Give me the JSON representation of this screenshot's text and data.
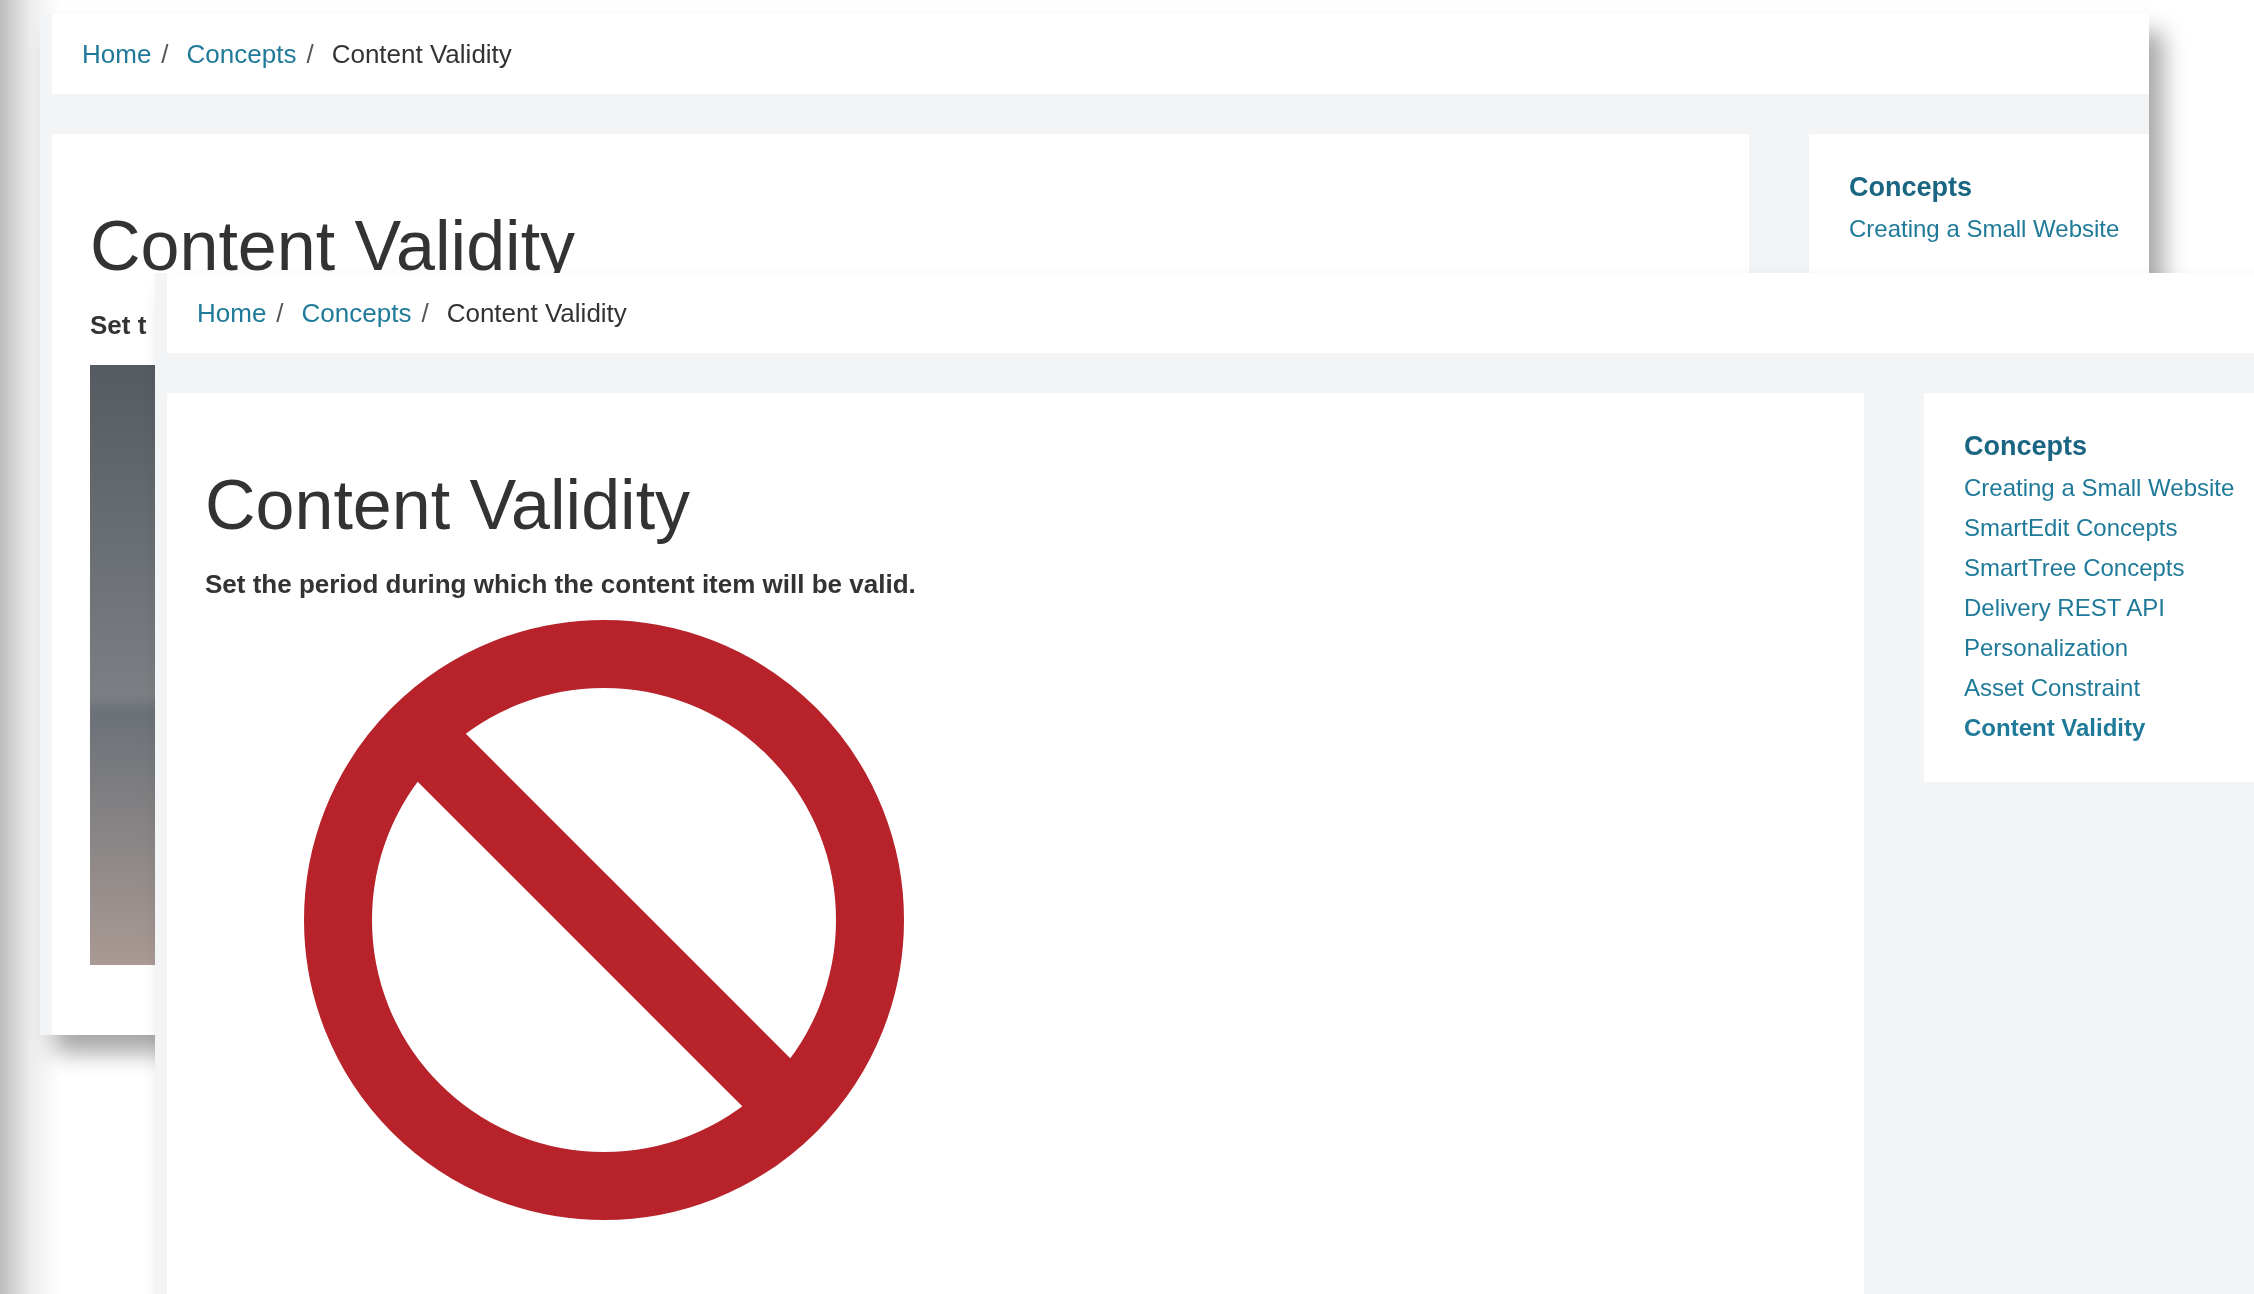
{
  "windows": [
    {
      "breadcrumb": [
        {
          "label": "Home",
          "current": false,
          "separator": "/"
        },
        {
          "label": "Concepts",
          "current": false,
          "separator": "/"
        },
        {
          "label": "Content Validity",
          "current": true
        }
      ],
      "title": "Content Validity",
      "intro": "Set t",
      "figure": {
        "kind": "photo"
      },
      "sidebar": {
        "heading": "Concepts",
        "items": [
          {
            "label": "Creating a Small Website",
            "selected": false
          }
        ]
      }
    },
    {
      "breadcrumb": [
        {
          "label": "Home",
          "current": false,
          "separator": "/"
        },
        {
          "label": "Concepts",
          "current": false,
          "separator": "/"
        },
        {
          "label": "Content Validity",
          "current": true
        }
      ],
      "title": "Content Validity",
      "intro": "Set the period during which the content item will be valid.",
      "figure": {
        "kind": "prohibition-sign"
      },
      "sidebar": {
        "heading": "Concepts",
        "items": [
          {
            "label": "Creating a Small Website",
            "selected": false
          },
          {
            "label": "SmartEdit Concepts",
            "selected": false
          },
          {
            "label": "SmartTree Concepts",
            "selected": false
          },
          {
            "label": "Delivery REST API",
            "selected": false
          },
          {
            "label": "Personalization",
            "selected": false
          },
          {
            "label": "Asset Constraint",
            "selected": false
          },
          {
            "label": "Content Validity",
            "selected": true
          }
        ]
      }
    }
  ]
}
